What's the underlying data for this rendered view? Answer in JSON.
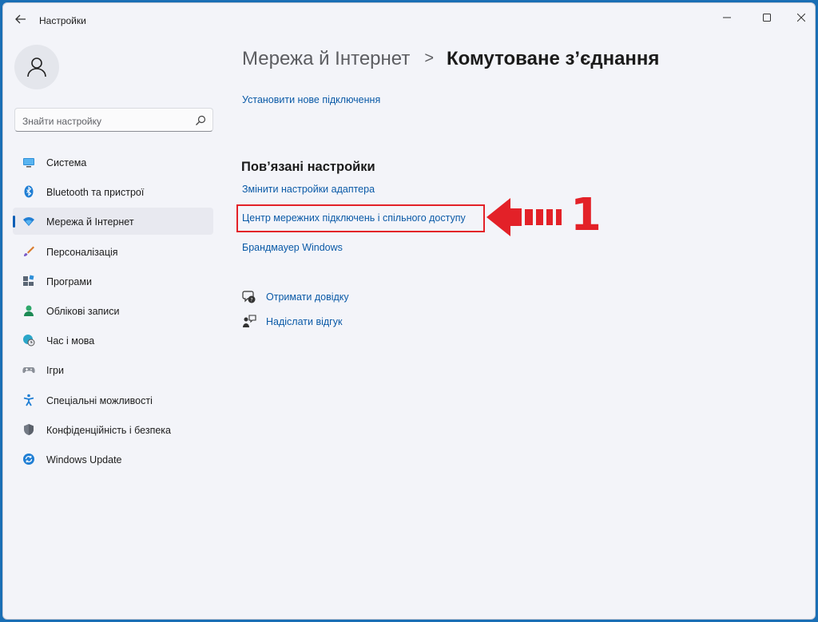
{
  "window": {
    "title": "Настройки"
  },
  "sidebar": {
    "search_placeholder": "Знайти настройку",
    "items": [
      {
        "label": "Система",
        "icon": "display-icon"
      },
      {
        "label": "Bluetooth та пристрої",
        "icon": "bluetooth-icon"
      },
      {
        "label": "Мережа й Інтернет",
        "icon": "wifi-icon",
        "active": true
      },
      {
        "label": "Персоналізація",
        "icon": "brush-icon"
      },
      {
        "label": "Програми",
        "icon": "apps-icon"
      },
      {
        "label": "Облікові записи",
        "icon": "person-icon"
      },
      {
        "label": "Час і мова",
        "icon": "globe-clock-icon"
      },
      {
        "label": "Ігри",
        "icon": "gamepad-icon"
      },
      {
        "label": "Спеціальні можливості",
        "icon": "accessibility-icon"
      },
      {
        "label": "Конфіденційність і безпека",
        "icon": "shield-icon"
      },
      {
        "label": "Windows Update",
        "icon": "update-icon"
      }
    ]
  },
  "main": {
    "breadcrumb_parent": "Мережа й Інтернет",
    "breadcrumb_separator": ">",
    "breadcrumb_current": "Комутоване з’єднання",
    "new_connection_link": "Установити нове підключення",
    "related_title": "Пов’язані настройки",
    "related_links": [
      "Змінити настройки адаптера",
      "Центр мережних підключень і спільного доступу",
      "Брандмауер Windows"
    ],
    "help_label": "Отримати довідку",
    "feedback_label": "Надіслати відгук"
  },
  "annotation": {
    "number": "1",
    "color": "#e32128"
  },
  "colors": {
    "accent": "#0f5fb6",
    "link": "#0a5aa7",
    "background": "#f3f4f9"
  }
}
